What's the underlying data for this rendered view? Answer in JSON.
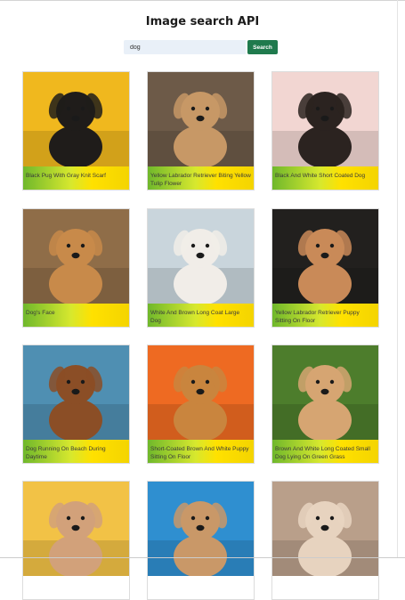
{
  "header": {
    "title": "Image search API"
  },
  "search": {
    "value": "dog",
    "button_label": "Search"
  },
  "results": [
    {
      "caption": "Black Pug With Gray Knit Scarf",
      "image": "pug-photo",
      "bg": "#f0b81e",
      "dog": "#1f1c1a"
    },
    {
      "caption": "Yellow Labrador Retriever Biting Yellow Tulip Flower",
      "image": "labrador-tulip-photo",
      "bg": "#6d5a48",
      "dog": "#c79866"
    },
    {
      "caption": "Black And White Short Coated Dog",
      "image": "short-coated-dog-photo",
      "bg": "#f2d6d2",
      "dog": "#2b2320"
    },
    {
      "caption": "Dog's Face",
      "image": "beagle-face-photo",
      "bg": "#8f6d48",
      "dog": "#c88a4a"
    },
    {
      "caption": "White And Brown Long Coat Large Dog",
      "image": "collie-photo",
      "bg": "#c9d5dc",
      "dog": "#f1ede8"
    },
    {
      "caption": "Yellow Labrador Retriever Puppy Sitting On Floor",
      "image": "lab-puppy-photo",
      "bg": "#22201e",
      "dog": "#c98a58"
    },
    {
      "caption": "Dog Running On Beach During Daytime",
      "image": "beach-dog-photo",
      "bg": "#4f8fb2",
      "dog": "#8b4e26"
    },
    {
      "caption": "Short-Coated Brown And White Puppy Sitting On Floor",
      "image": "corgi-photo",
      "bg": "#ee6a22",
      "dog": "#c9853e"
    },
    {
      "caption": "Brown And White Long Coated Small Dog Lying On Green Grass",
      "image": "dog-on-grass-photo",
      "bg": "#4d7d2c",
      "dog": "#d6a572"
    },
    {
      "caption": "",
      "image": "french-bulldog-photo",
      "bg": "#f2c246",
      "dog": "#d2a17a"
    },
    {
      "caption": "",
      "image": "bulldog-jacket-photo",
      "bg": "#2f8fd0",
      "dog": "#c99868"
    },
    {
      "caption": "",
      "image": "puppy-outdoors-photo",
      "bg": "#b99f8a",
      "dog": "#e7d3bf"
    }
  ]
}
